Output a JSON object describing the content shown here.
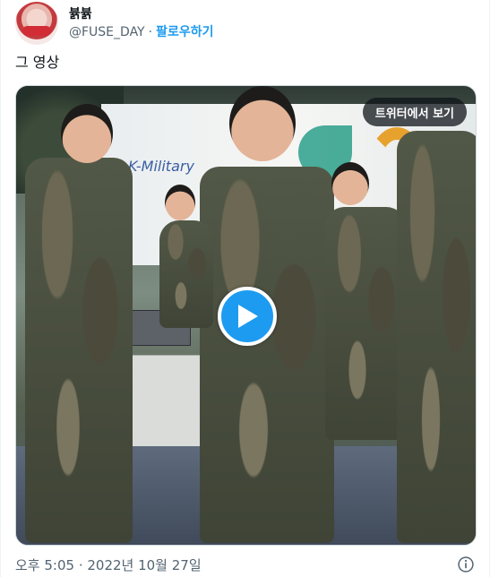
{
  "author": {
    "display_name": "뷹뷹",
    "handle": "@FUSE_DAY",
    "separator": "·",
    "follow_label": "팔로우하기"
  },
  "tweet": {
    "text": "그 영상"
  },
  "media": {
    "badge_label": "트위터에서 보기",
    "play_icon": "play-icon",
    "banner_text": "K-Military"
  },
  "footer": {
    "timestamp": "오후 5:05 · 2022년 10월 27일",
    "info_icon": "info-icon"
  },
  "colors": {
    "accent": "#1d9bf0",
    "secondary_text": "#536471"
  }
}
